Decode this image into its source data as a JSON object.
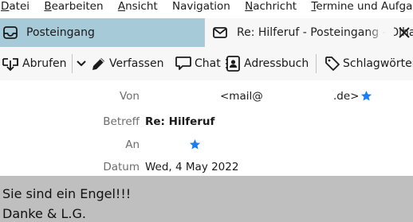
{
  "menubar": {
    "items": [
      {
        "mnemonic": "D",
        "rest": "atei"
      },
      {
        "mnemonic": "B",
        "rest": "earbeiten"
      },
      {
        "mnemonic": "A",
        "rest": "nsicht"
      },
      {
        "pre": "Navi",
        "mnemonic": "g",
        "rest": "ation"
      },
      {
        "mnemonic": "N",
        "rest": "achricht"
      },
      {
        "mnemonic": "T",
        "rest": "ermine und Aufgaben"
      }
    ]
  },
  "tabs": {
    "inbox_label": "Posteingang",
    "message_label": "Re: Hilferuf - Posteingang - Olhasso"
  },
  "toolbar": {
    "fetch_label": "Abrufen",
    "compose_label": "Verfassen",
    "chat_label": "Chat",
    "addressbook_label": "Adressbuch",
    "tags_label": "Schlagwörter"
  },
  "header": {
    "from_label": "Von",
    "from_value_start": "<mail@",
    "from_value_end": ".de>",
    "subject_label": "Betreff",
    "subject_value": "Re: Hilferuf",
    "to_label": "An",
    "date_label": "Datum",
    "date_value": "Wed, 4 May 2022"
  },
  "body": {
    "line1": "Sie sind ein Engel!!!",
    "line2": "Danke & L.G."
  },
  "colors": {
    "tabbar": "#a7cad8",
    "star": "#1c7cf3",
    "body_bg": "#bfbfbf"
  }
}
